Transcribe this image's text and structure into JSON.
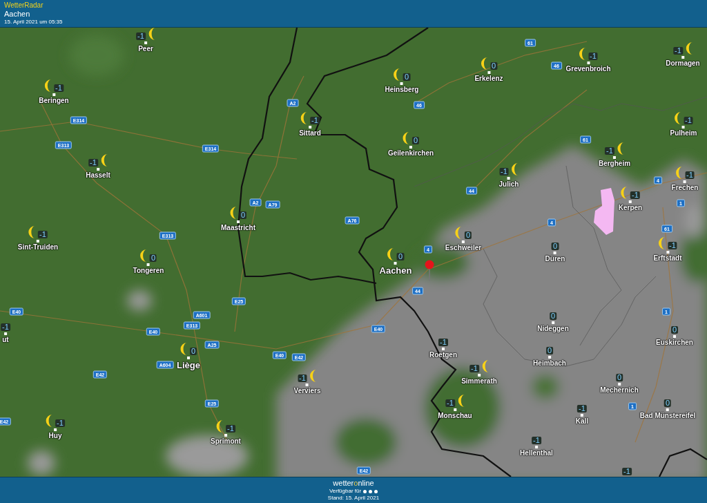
{
  "header": {
    "app_name": "WetterRadar",
    "location": "Aachen",
    "timestamp": "15. April 2021 um 05:35"
  },
  "map": {
    "cities": [
      {
        "name": "Peer",
        "temperature": "-1",
        "moon": true,
        "major": false
      },
      {
        "name": "Beringen",
        "temperature": "-1",
        "moon": true,
        "major": false
      },
      {
        "name": "Hasselt",
        "temperature": "-1",
        "moon": true,
        "major": false
      },
      {
        "name": "Sittard",
        "temperature": "-1",
        "moon": true,
        "major": false
      },
      {
        "name": "Maastricht",
        "temperature": "0",
        "moon": true,
        "major": false
      },
      {
        "name": "Sint-Truiden",
        "temperature": "-1",
        "moon": true,
        "major": false
      },
      {
        "name": "Heinsberg",
        "temperature": "0",
        "moon": true,
        "major": false
      },
      {
        "name": "Erkelenz",
        "temperature": "0",
        "moon": true,
        "major": false
      },
      {
        "name": "Grevenbroich",
        "temperature": "-1",
        "moon": true,
        "major": false
      },
      {
        "name": "Dormagen",
        "temperature": "-1",
        "moon": true,
        "major": false
      },
      {
        "name": "Geilenkirchen",
        "temperature": "0",
        "moon": true,
        "major": false
      },
      {
        "name": "Julich",
        "temperature": "-1",
        "moon": true,
        "major": false
      },
      {
        "name": "Bergheim",
        "temperature": "-1",
        "moon": true,
        "major": false
      },
      {
        "name": "Pulheim",
        "temperature": "-1",
        "moon": true,
        "major": false
      },
      {
        "name": "Frechen",
        "temperature": "-1",
        "moon": true,
        "major": false
      },
      {
        "name": "Kerpen",
        "temperature": "-1",
        "moon": true,
        "major": false
      },
      {
        "name": "Eschweiler",
        "temperature": "0",
        "moon": true,
        "major": false
      },
      {
        "name": "Tongeren",
        "temperature": "0",
        "moon": true,
        "major": false
      },
      {
        "name": "Aachen",
        "temperature": "0",
        "moon": true,
        "major": true
      },
      {
        "name": "Düren",
        "temperature": "0",
        "moon": false,
        "major": false
      },
      {
        "name": "Erftstadt",
        "temperature": "-1",
        "moon": true,
        "major": false
      },
      {
        "name": "ut",
        "temperature": "-1",
        "moon": false,
        "major": false
      },
      {
        "name": "Nideggen",
        "temperature": "0",
        "moon": false,
        "major": false
      },
      {
        "name": "Euskirchen",
        "temperature": "0",
        "moon": false,
        "major": false
      },
      {
        "name": "Liège",
        "temperature": "0",
        "moon": true,
        "major": true
      },
      {
        "name": "Roetgen",
        "temperature": "-1",
        "moon": false,
        "major": false
      },
      {
        "name": "Heimbach",
        "temperature": "0",
        "moon": false,
        "major": false
      },
      {
        "name": "Simmerath",
        "temperature": "-1",
        "moon": true,
        "major": false
      },
      {
        "name": "Verviers",
        "temperature": "-1",
        "moon": true,
        "major": false
      },
      {
        "name": "Mechernich",
        "temperature": "0",
        "moon": false,
        "major": false
      },
      {
        "name": "Monschau",
        "temperature": "-1",
        "moon": true,
        "major": false
      },
      {
        "name": "Kall",
        "temperature": "-1",
        "moon": false,
        "major": false
      },
      {
        "name": "Bad Münstereifel",
        "temperature": "0",
        "moon": false,
        "major": false
      },
      {
        "name": "Huy",
        "temperature": "-1",
        "moon": true,
        "major": false
      },
      {
        "name": "Sprimont",
        "temperature": "-1",
        "moon": true,
        "major": false
      },
      {
        "name": "Hellenthal",
        "temperature": "-1",
        "moon": false,
        "major": false
      },
      {
        "temperature": "-1",
        "moon": false
      }
    ],
    "road_numbers": [
      "E314",
      "E313",
      "E314",
      "A2",
      "A2",
      "A79",
      "A76",
      "E313",
      "61",
      "46",
      "46",
      "61",
      "44",
      "4",
      "1",
      "61",
      "4",
      "4",
      "44",
      "E40",
      "E40",
      "A601",
      "E313",
      "A25",
      "E25",
      "E40",
      "E42",
      "E40",
      "A604",
      "E42",
      "E25",
      "E42",
      "E42",
      "1",
      "1"
    ]
  },
  "footer": {
    "logo": [
      "wetter",
      "o",
      "nline"
    ],
    "availability": "Verfügbar für",
    "date": "Stand: 15. April 2021"
  }
}
